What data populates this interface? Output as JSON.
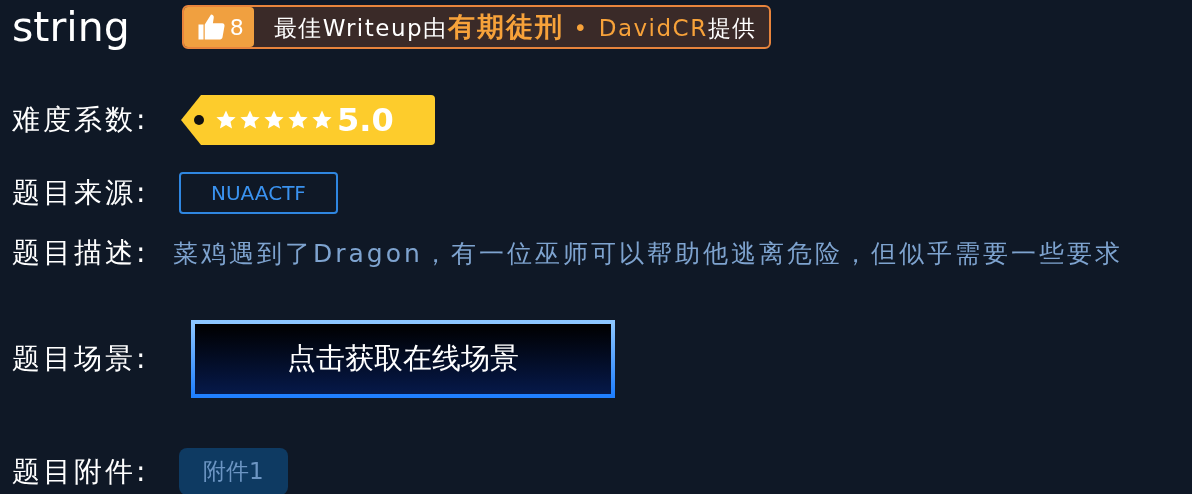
{
  "title": "string",
  "writeup": {
    "likes": "8",
    "prefix": "最佳Writeup由",
    "author": "有期徒刑",
    "separator": "•",
    "provider": "DavidCR",
    "suffix": "提供"
  },
  "difficulty": {
    "label": "难度系数:",
    "stars": 5,
    "rating": "5.0"
  },
  "source": {
    "label": "题目来源:",
    "value": "NUAACTF"
  },
  "description": {
    "label": "题目描述:",
    "text": "菜鸡遇到了Dragon，有一位巫师可以帮助他逃离危险，但似乎需要一些要求"
  },
  "scene": {
    "label": "题目场景:",
    "button": "点击获取在线场景"
  },
  "attachments": {
    "label": "题目附件:",
    "files": [
      "附件1"
    ]
  }
}
